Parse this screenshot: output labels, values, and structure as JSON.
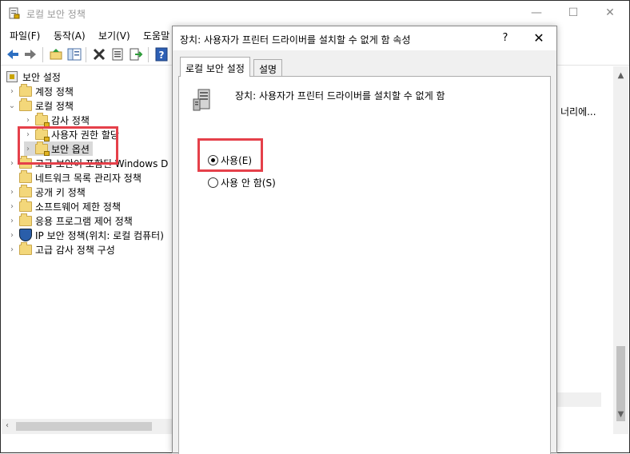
{
  "main_window": {
    "title": "로컬 보안 정책",
    "controls": {
      "minimize": "—",
      "maximize": "☐",
      "close": "✕"
    }
  },
  "menubar": {
    "items": [
      "파일(F)",
      "동작(A)",
      "보기(V)",
      "도움말"
    ]
  },
  "toolbar": {
    "buttons": [
      "back-arrow-icon",
      "forward-arrow-icon",
      "up-folder-icon",
      "show-hide-tree-icon",
      "delete-icon",
      "properties-icon",
      "export-icon",
      "help-icon"
    ]
  },
  "tree": {
    "root": "보안 설정",
    "items": [
      {
        "label": "계정 정책",
        "chevron": "›"
      },
      {
        "label": "로컬 정책",
        "chevron": "⌄"
      },
      {
        "label": "감사 정책",
        "chevron": "›"
      },
      {
        "label": "사용자 권한 할당",
        "chevron": "›"
      },
      {
        "label": "보안 옵션",
        "chevron": "›"
      },
      {
        "label": "고급 보안이 포함된 Windows D",
        "chevron": "›"
      },
      {
        "label": "네트워크 목록 관리자 정책",
        "chevron": ""
      },
      {
        "label": "공개 키 정책",
        "chevron": "›"
      },
      {
        "label": "소프트웨어 제한 정책",
        "chevron": "›"
      },
      {
        "label": "응용 프로그램 제어 정책",
        "chevron": "›"
      },
      {
        "label": "IP 보안 정책(위치: 로컬 컴퓨터)",
        "chevron": "›"
      },
      {
        "label": "고급 감사 정책 구성",
        "chevron": "›"
      }
    ]
  },
  "right_pane": {
    "partial_text": "너리에..."
  },
  "dialog": {
    "title": "장치: 사용자가 프린터 드라이버를 설치할 수 없게 함 속성",
    "help": "?",
    "close": "✕",
    "tabs": [
      "로컬 보안 설정",
      "설명"
    ],
    "policy_name": "장치: 사용자가 프린터 드라이버를 설치할 수 없게 함",
    "options": [
      {
        "label": "사용(E)",
        "checked": true
      },
      {
        "label": "사용 안 함(S)",
        "checked": false
      }
    ]
  },
  "colors": {
    "highlight": "#e5404a"
  }
}
